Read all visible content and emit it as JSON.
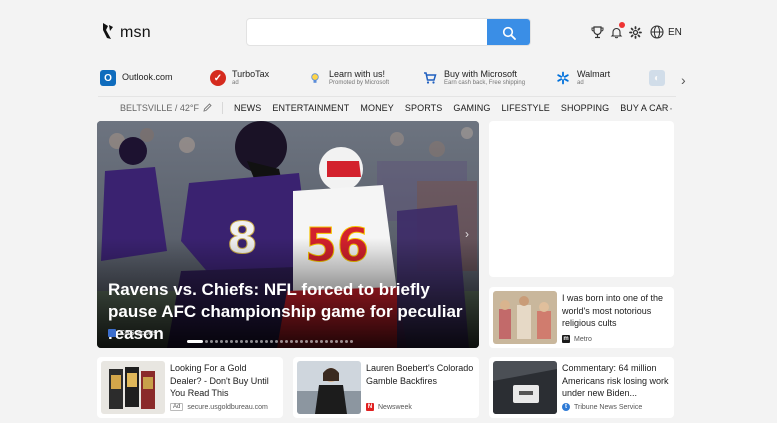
{
  "header": {
    "brand": "msn",
    "search_placeholder": "",
    "language": "EN"
  },
  "quick_links": [
    {
      "name": "Outlook.com",
      "sub": "",
      "color": "#0f6cbd"
    },
    {
      "name": "TurboTax",
      "sub": "ad",
      "color": "#d52b1e"
    },
    {
      "name": "Learn with us!",
      "sub": "Promoted by Microsoft",
      "color": "#5b8dd9"
    },
    {
      "name": "Buy with Microsoft",
      "sub": "Earn cash back, Free shipping",
      "color": "#1f5fbf"
    },
    {
      "name": "Walmart",
      "sub": "ad",
      "color": "#0071dc"
    }
  ],
  "nav": {
    "location": "BELTSVILLE / 42°F",
    "items": [
      "NEWS",
      "ENTERTAINMENT",
      "MONEY",
      "SPORTS",
      "GAMING",
      "LIFESTYLE",
      "SHOPPING",
      "BUY A CAR"
    ],
    "more": "···"
  },
  "hero": {
    "headline": "Ravens vs. Chiefs: NFL forced to briefly pause AFC championship game for peculiar reason",
    "source": "CBS Sports",
    "jersey_left": "8",
    "jersey_right": "56",
    "slide_count": 31,
    "active_slide": 0
  },
  "cards": {
    "metro": {
      "title": "I was born into one of the world's most notorious religious cults",
      "source": "Metro"
    },
    "gold": {
      "title": "Looking For a Gold Dealer? - Don't Buy Until You Read This",
      "ad": "Ad",
      "source": "secure.usgoldbureau.com"
    },
    "newsweek": {
      "title": "Lauren Boebert's Colorado Gamble Backfires",
      "source": "Newsweek"
    },
    "tribune": {
      "title": "Commentary: 64 million Americans risk losing work under new Biden...",
      "source": "Tribune News Service"
    }
  },
  "colors": {
    "search_button": "#3a8ee6",
    "ravens_purple": "#3a2270",
    "chiefs_red": "#d3212d",
    "notification_dot": "#e33333"
  },
  "icons": [
    "msn-logo-icon",
    "search-icon",
    "rewards-trophy-icon",
    "bell-icon",
    "gear-icon",
    "globe-icon",
    "pencil-icon",
    "chevron-right-icon"
  ]
}
